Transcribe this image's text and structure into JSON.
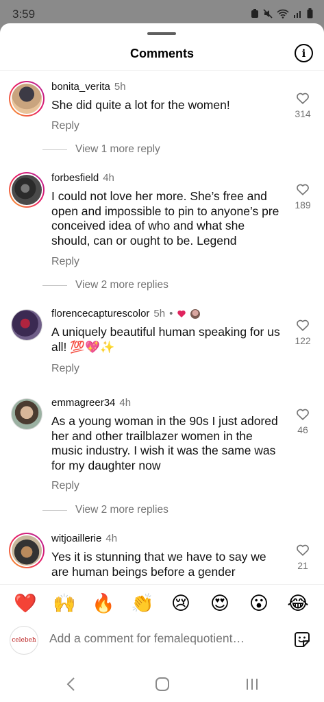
{
  "status_bar": {
    "time": "3:59"
  },
  "header": {
    "title": "Comments",
    "info_icon": "info-icon"
  },
  "comments": [
    {
      "username": "bonita_verita",
      "time": "5h",
      "text": "She did quite a lot for the women!",
      "reply_label": "Reply",
      "likes": "314",
      "view_more": "View 1 more reply"
    },
    {
      "username": "forbesfield",
      "time": "4h",
      "text": "I could not love her more. She’s free and open and impossible to pin to anyone’s pre conceived idea of who and what she should, can or ought to be. Legend",
      "reply_label": "Reply",
      "likes": "189",
      "view_more": "View 2 more replies"
    },
    {
      "username": "florencecapturescolor",
      "time": "5h",
      "separator": "•",
      "text": "A uniquely beautiful human speaking for us all! 💯💖✨",
      "reply_label": "Reply",
      "likes": "122"
    },
    {
      "username": "emmagreer34",
      "time": "4h",
      "text": "As a young woman in the 90s I just adored her and other trailblazer women in the music industry. I wish it was the same was for my daughter now",
      "reply_label": "Reply",
      "likes": "46",
      "view_more": "View 2 more replies"
    },
    {
      "username": "witjoaillerie",
      "time": "4h",
      "text": "Yes it is stunning that we have to say we are human beings before a gender",
      "likes": "21"
    }
  ],
  "emoji_reactions": [
    "❤️",
    "🙌",
    "🔥",
    "👏",
    "😢",
    "😍",
    "😮",
    "😂"
  ],
  "composer": {
    "placeholder": "Add a comment for femalequotient…",
    "avatar_text": "celebeh"
  },
  "colors": {
    "like_count": "#737373",
    "ring_start": "#f9a825",
    "ring_end": "#b0249c",
    "heart_red": "#e0245e"
  }
}
